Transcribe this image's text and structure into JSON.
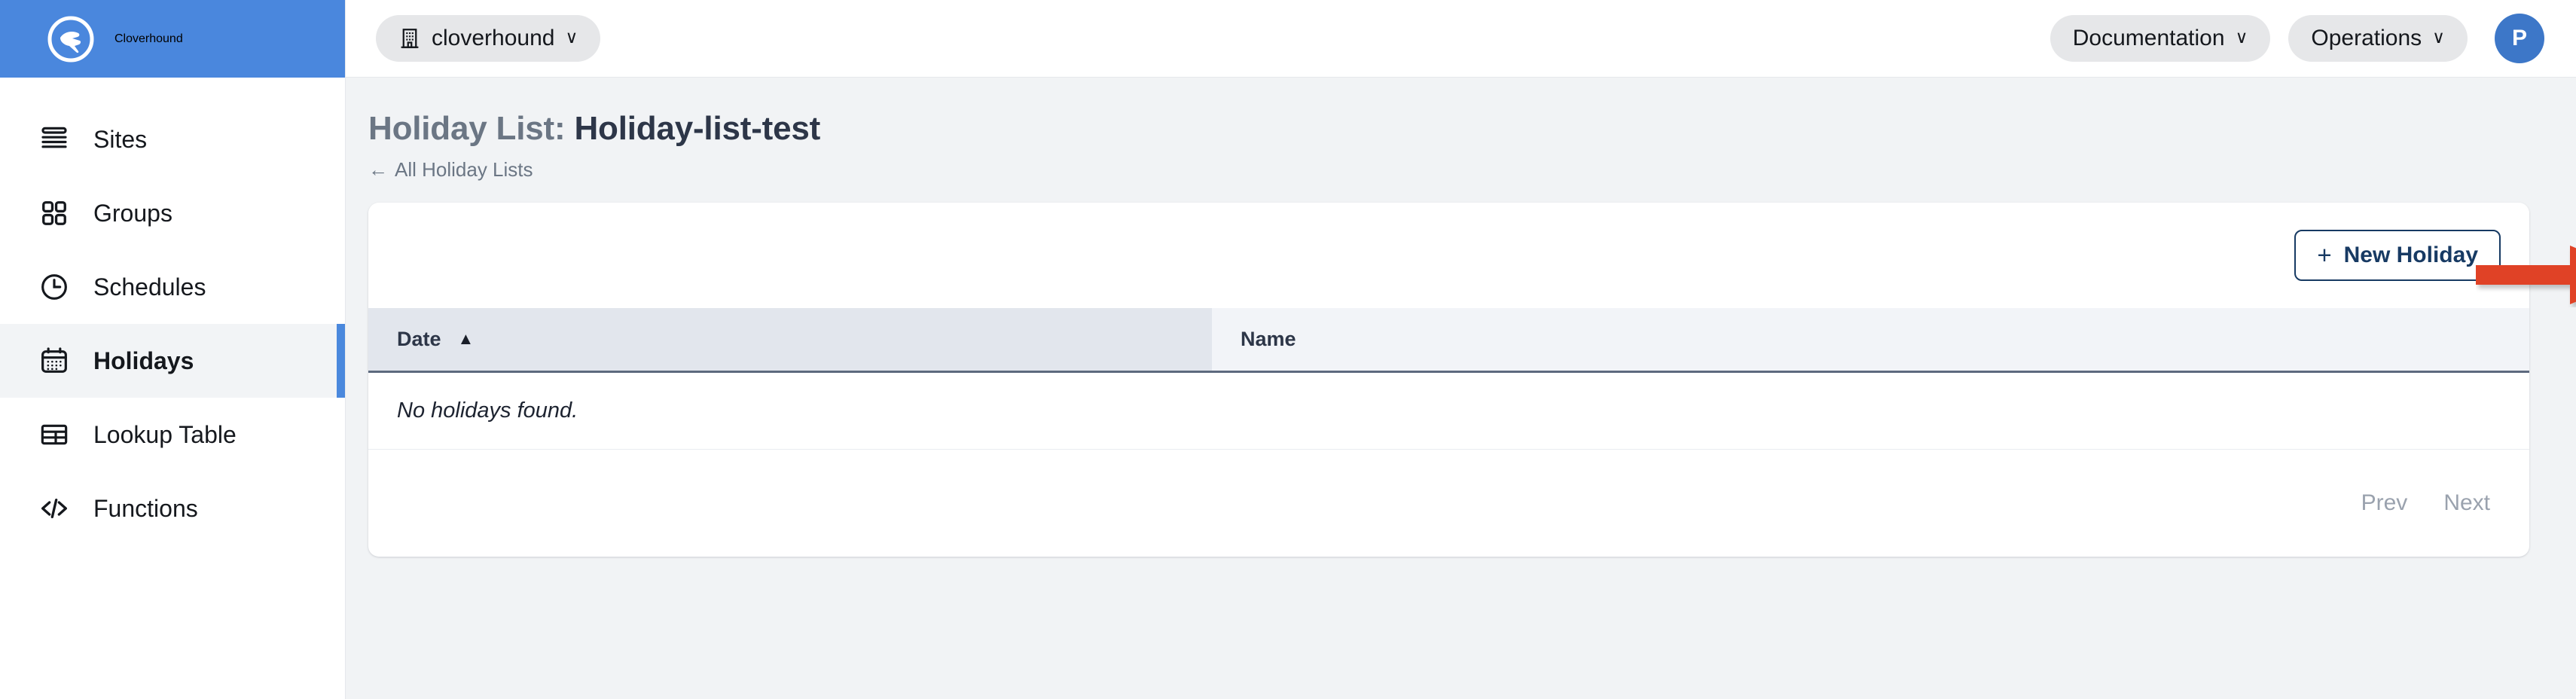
{
  "brand": {
    "name": "Cloverhound",
    "logo_icon": "cloverhound-hound-logo",
    "bar_color": "#4a87dd"
  },
  "sidebar": {
    "items": [
      {
        "label": "Sites",
        "icon": "layers-icon",
        "active": false
      },
      {
        "label": "Groups",
        "icon": "grid-2x2-icon",
        "active": false
      },
      {
        "label": "Schedules",
        "icon": "clock-icon",
        "active": false
      },
      {
        "label": "Holidays",
        "icon": "calendar-icon",
        "active": true
      },
      {
        "label": "Lookup Table",
        "icon": "table-grid-icon",
        "active": false
      },
      {
        "label": "Functions",
        "icon": "code-brackets-icon",
        "active": false
      }
    ],
    "active_accent_color": "#4a88dd"
  },
  "topbar": {
    "tenant_selector": {
      "label": "cloverhound",
      "icon": "building-icon",
      "chevron": "∨"
    },
    "documentation_menu": {
      "label": "Documentation",
      "chevron": "∨"
    },
    "operations_menu": {
      "label": "Operations",
      "chevron": "∨"
    },
    "avatar": {
      "initial": "P",
      "color": "#3d77c8"
    }
  },
  "page": {
    "title_prefix": "Holiday List:",
    "title_value": "Holiday-list-test",
    "breadcrumb": {
      "arrow": "←",
      "label": "All Holiday Lists"
    }
  },
  "card": {
    "new_holiday_button": {
      "plus": "+",
      "label": "New Holiday",
      "color": "#173a63"
    },
    "table": {
      "columns": [
        {
          "key": "date",
          "label": "Date",
          "sorted": true,
          "sort_direction": "asc",
          "sort_caret": "▲"
        },
        {
          "key": "name",
          "label": "Name",
          "sorted": false,
          "sort_direction": "",
          "sort_caret": ""
        }
      ],
      "rows": [],
      "empty_message": "No holidays found."
    },
    "pagination": {
      "prev_label": "Prev",
      "next_label": "Next",
      "disabled": true
    }
  },
  "annotation": {
    "arrow": {
      "type": "right-arrow",
      "color": "#e04226",
      "points_to": "new-holiday-button"
    }
  }
}
